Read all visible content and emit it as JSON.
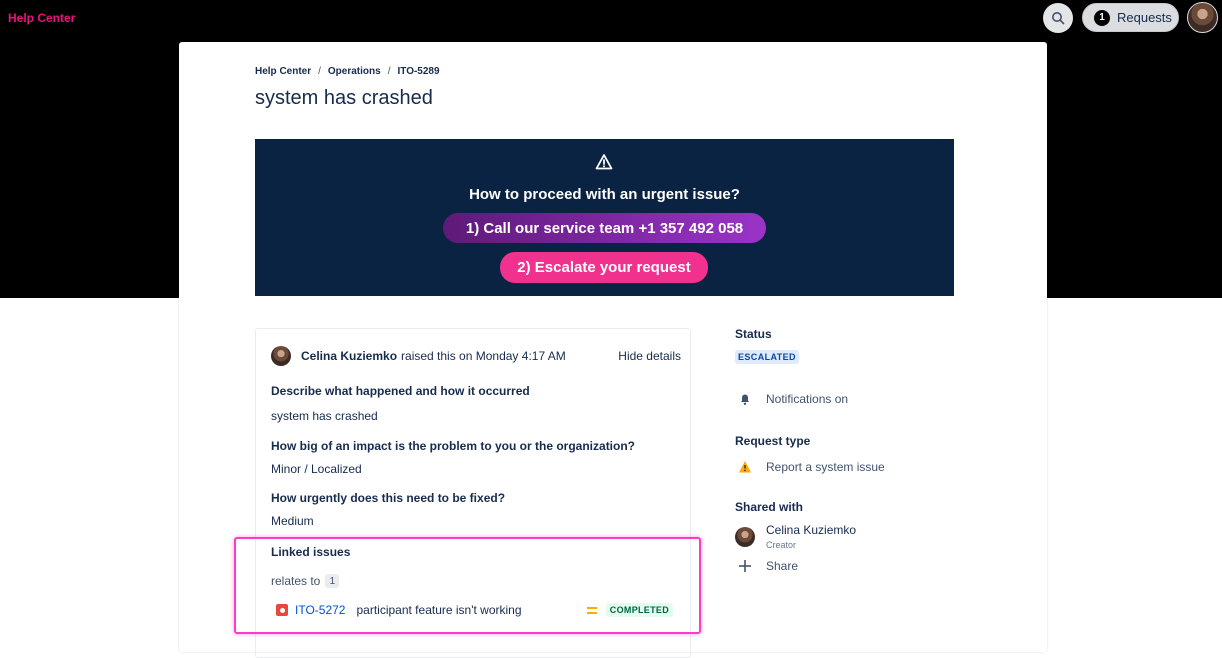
{
  "topbar": {
    "brand": "Help Center",
    "requests_label": "Requests",
    "requests_count": "1"
  },
  "breadcrumb": {
    "items": [
      "Help Center",
      "Operations",
      "ITO-5289"
    ],
    "separator": "/"
  },
  "page_title": "system has crashed",
  "alert": {
    "title": "How to proceed with an urgent issue?",
    "call_button": "1) Call our service team +1 357 492 058",
    "escalate_button": "2) Escalate your request"
  },
  "details": {
    "reporter_name": "Celina Kuziemko",
    "reporter_text": "raised this on Monday 4:17 AM",
    "hide_details": "Hide details",
    "fields": [
      {
        "question": "Describe what happened and how it occurred",
        "answer": "system has crashed"
      },
      {
        "question": "How big of an impact is the problem to you or the organization?",
        "answer": "Minor / Localized"
      },
      {
        "question": "How urgently does this need to be fixed?",
        "answer": "Medium"
      }
    ],
    "linked_issues": {
      "title": "Linked issues",
      "relation": "relates to",
      "relation_count": "1",
      "items": [
        {
          "key": "ITO-5272",
          "summary": "participant feature isn't working",
          "status": "COMPLETED"
        }
      ]
    }
  },
  "sidebar": {
    "status_label": "Status",
    "status_value": "ESCALATED",
    "notifications": "Notifications on",
    "request_type_label": "Request type",
    "request_type_value": "Report a system issue",
    "shared_with_label": "Shared with",
    "shared_user_name": "Celina Kuziemko",
    "shared_user_role": "Creator",
    "share_label": "Share"
  },
  "colors": {
    "brand": "#e8127b",
    "alert_bg": "#0a2342",
    "escalate": "#f0318e",
    "link": "#0052cc",
    "highlight": "#ff3cc7"
  },
  "icons": {
    "search": "search-icon",
    "warning": "warning-icon",
    "bell": "bell-icon",
    "bug": "bug-icon",
    "priority": "priority-medium-icon",
    "add": "plus-icon"
  }
}
